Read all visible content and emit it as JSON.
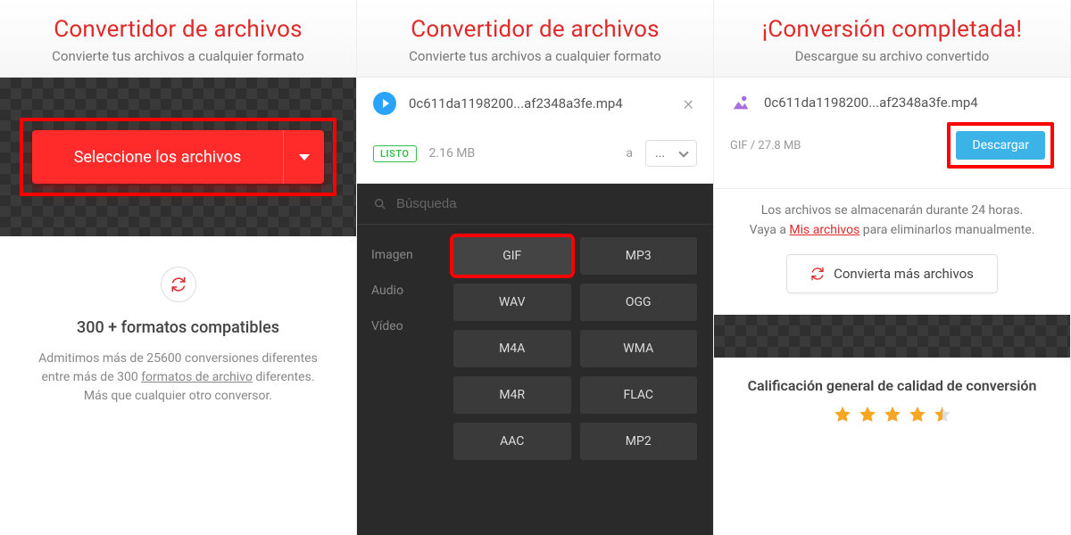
{
  "panel1": {
    "title": "Convertidor de archivos",
    "subtitle": "Convierte tus archivos a cualquier formato",
    "select_button": "Seleccione los archivos",
    "formats_title": "300 + formatos compatibles",
    "formats_desc_pre": "Admitimos más de 25600 conversiones diferentes entre más de 300 ",
    "formats_desc_link": "formatos de archivo",
    "formats_desc_post": " diferentes. Más que cualquier otro conversor."
  },
  "panel2": {
    "title": "Convertidor de archivos",
    "subtitle": "Convierte tus archivos a cualquier formato",
    "file_name": "0c611da1198200...af2348a3fe.mp4",
    "badge": "LISTO",
    "size": "2.16 MB",
    "to_label": "a",
    "target_value": "...",
    "search_placeholder": "Búsqueda",
    "categories": [
      "Imagen",
      "Audio",
      "Vídeo"
    ],
    "formats": [
      "GIF",
      "MP3",
      "WAV",
      "OGG",
      "M4A",
      "WMA",
      "M4R",
      "FLAC",
      "AAC",
      "MP2"
    ],
    "highlighted_format": "GIF"
  },
  "panel3": {
    "title": "¡Conversión completada!",
    "subtitle": "Descargue su archivo convertido",
    "file_name": "0c611da1198200...af2348a3fe.mp4",
    "result_meta": "GIF / 27.8 MB",
    "download_label": "Descargar",
    "storage_pre": "Los archivos se almacenarán durante 24 horas. Vaya a ",
    "storage_link": "Mis archivos",
    "storage_post": " para eliminarlos manualmente.",
    "convert_more": "Convierta más archivos",
    "rating_title": "Calificación general de calidad de conversión",
    "rating": 4.5
  }
}
